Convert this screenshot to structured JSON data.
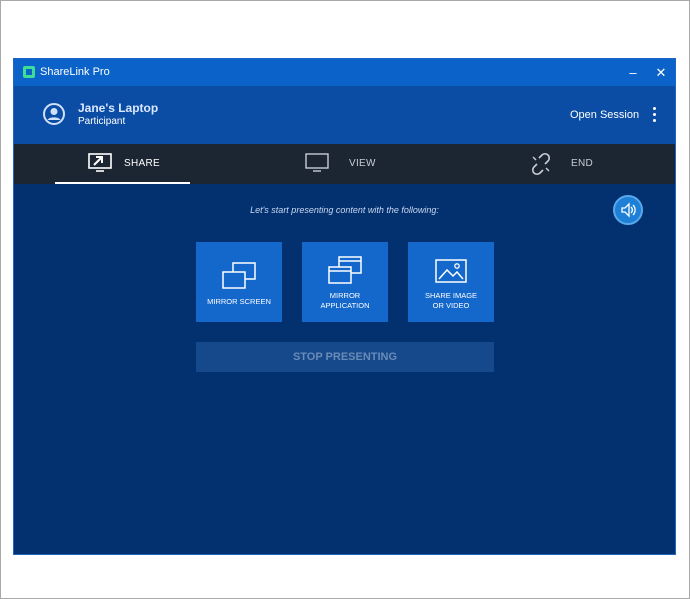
{
  "window": {
    "title": "ShareLink Pro",
    "minimize_label": "–",
    "close_label": "✕"
  },
  "header": {
    "device_name": "Jane's Laptop",
    "role": "Participant",
    "open_session": "Open Session"
  },
  "tabs": [
    {
      "label": "SHARE",
      "icon": "share-screen-icon",
      "active": true
    },
    {
      "label": "VIEW",
      "icon": "monitor-icon",
      "active": false
    },
    {
      "label": "END",
      "icon": "broken-link-icon",
      "active": false
    }
  ],
  "main": {
    "intro": "Let's start presenting content with the following:",
    "tiles": [
      {
        "label": "MIRROR SCREEN",
        "icon": "mirror-screen-icon"
      },
      {
        "label": "MIRROR\nAPPLICATION",
        "icon": "mirror-application-icon"
      },
      {
        "label": "SHARE IMAGE\nOR VIDEO",
        "icon": "image-icon"
      }
    ],
    "stop_label": "STOP PRESENTING",
    "sound_icon": "speaker-icon"
  },
  "colors": {
    "background": "#03306e",
    "titlebar": "#0b63c9",
    "header": "#0b4da5",
    "tabbar": "#1c2633",
    "tile": "#1467cb"
  }
}
